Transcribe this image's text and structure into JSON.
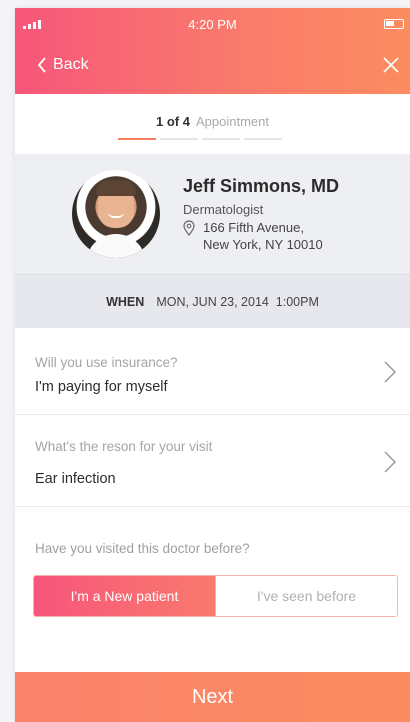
{
  "status_bar": {
    "time": "4:20 PM"
  },
  "nav": {
    "back_label": "Back"
  },
  "steps": {
    "count": "1 of 4",
    "label": "Appointment",
    "total": 4,
    "current": 1
  },
  "doctor": {
    "name": "Jeff Simmons, MD",
    "specialty": "Dermatologist",
    "address_line1": "166 Fifth Avenue,",
    "address_line2": "New York, NY 10010"
  },
  "when": {
    "label": "WHEN",
    "value": "MON, JUN 23, 2014  1:00PM"
  },
  "insurance": {
    "question": "Will you use insurance?",
    "answer": "I'm paying for myself"
  },
  "reason": {
    "question": "What's the reson for your visit",
    "answer": "Ear infection"
  },
  "visited": {
    "question": "Have you visited this doctor before?",
    "options": [
      "I'm a New patient",
      "I've seen before"
    ],
    "selected": 0
  },
  "next_label": "Next",
  "colors": {
    "accent_start": "#f7567a",
    "accent_end": "#fb8c5f"
  }
}
